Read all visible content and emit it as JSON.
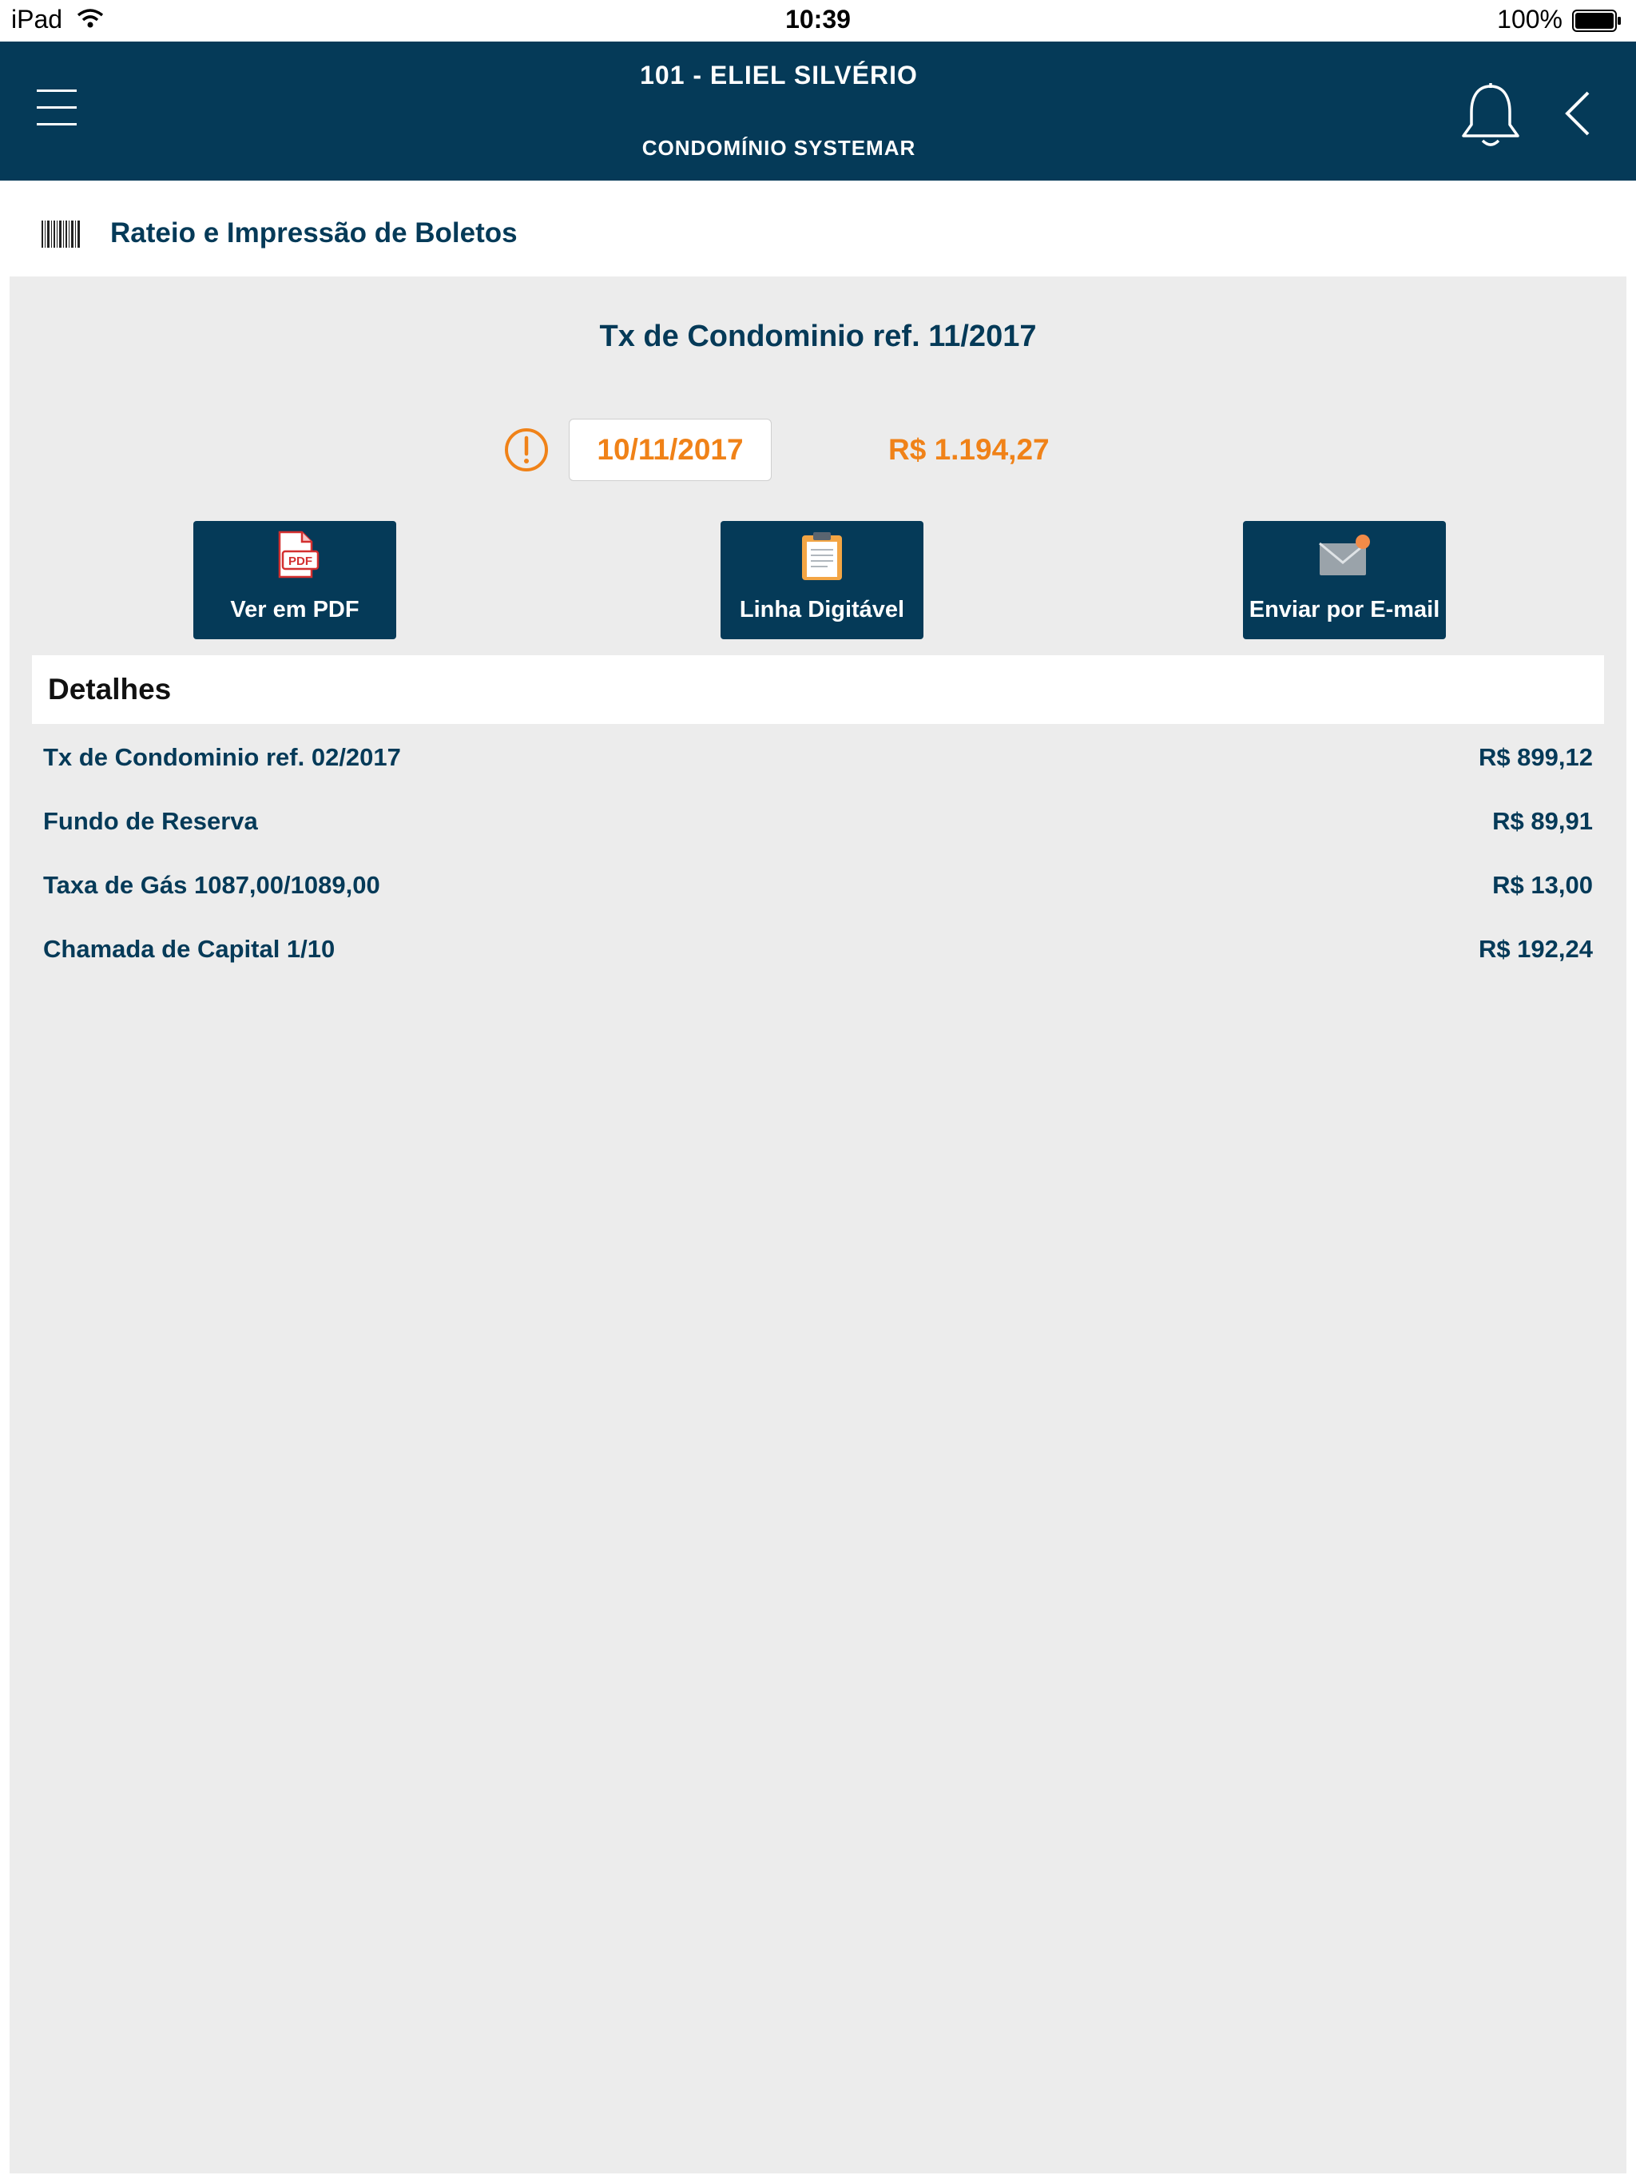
{
  "status_bar": {
    "carrier": "iPad",
    "time": "10:39",
    "battery": "100%",
    "wifi_icon": "wifi-icon",
    "battery_icon": "battery-icon"
  },
  "navbar": {
    "title": "101 - ELIEL SILVÉRIO",
    "subtitle": "CONDOMÍNIO SYSTEMAR",
    "menu_icon": "hamburger-menu-icon",
    "bell_icon": "bell-icon",
    "back_icon": "chevron-left-icon"
  },
  "section": {
    "icon": "barcode-icon",
    "title": "Rateio e Impressão de Boletos"
  },
  "invoice": {
    "title": "Tx de Condominio ref. 11/2017",
    "alert_icon": "alert-circle-icon",
    "due_date": "10/11/2017",
    "total": "R$ 1.194,27"
  },
  "actions": {
    "pdf": {
      "label": "Ver em PDF",
      "icon": "pdf-icon"
    },
    "line": {
      "label": "Linha Digitável",
      "icon": "clipboard-icon"
    },
    "email": {
      "label": "Enviar por E-mail",
      "icon": "mail-icon"
    }
  },
  "details": {
    "title": "Detalhes",
    "items": [
      {
        "description": "Tx de Condominio ref. 02/2017",
        "amount": "R$ 899,12"
      },
      {
        "description": "Fundo de Reserva",
        "amount": "R$ 89,91"
      },
      {
        "description": "Taxa de Gás 1087,00/1089,00",
        "amount": "R$ 13,00"
      },
      {
        "description": "Chamada de Capital 1/10",
        "amount": "R$ 192,24"
      }
    ]
  },
  "colors": {
    "primary": "#053a58",
    "accent": "#f08218",
    "background": "#ececec"
  }
}
